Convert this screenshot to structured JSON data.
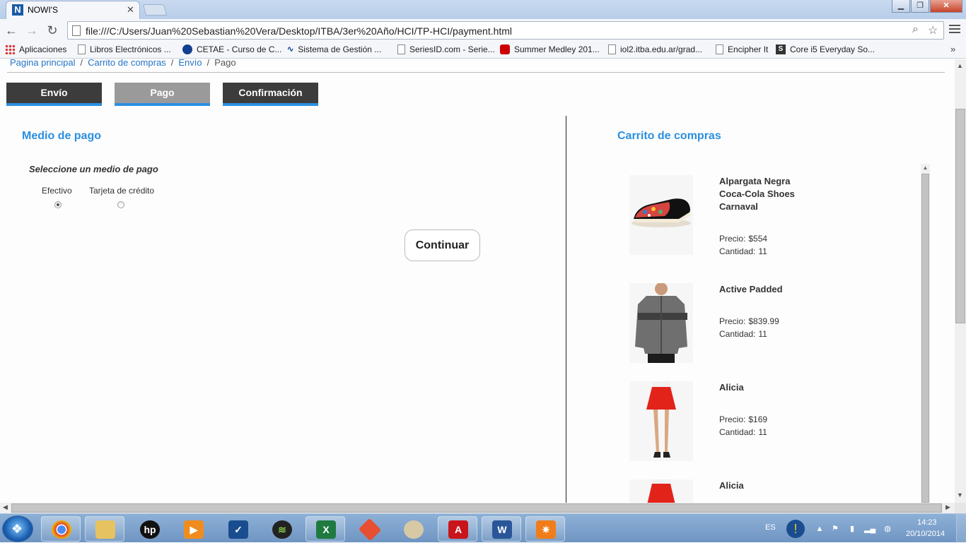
{
  "browser": {
    "tab_title": "NOWI'S",
    "tab_favicon": "N",
    "url": "file:///C:/Users/Juan%20Sebastian%20Vera/Desktop/ITBA/3er%20Año/HCI/TP-HCI/payment.html",
    "bookmarks": [
      {
        "label": "Aplicaciones",
        "icon": "apps-grid-icon"
      },
      {
        "label": "Libros Electrónicos ...",
        "icon": "page-icon"
      },
      {
        "label": "CETAE - Curso de C...",
        "icon": "cetae-icon"
      },
      {
        "label": "Sistema de Gestión ...",
        "icon": "wave-icon"
      },
      {
        "label": "SeriesID.com - Serie...",
        "icon": "page-icon"
      },
      {
        "label": "Summer Medley 201...",
        "icon": "youtube-icon"
      },
      {
        "label": "iol2.itba.edu.ar/grad...",
        "icon": "page-icon"
      },
      {
        "label": "Encipher It",
        "icon": "page-icon"
      },
      {
        "label": "Core i5 Everyday So...",
        "icon": "s-icon"
      }
    ]
  },
  "page": {
    "breadcrumb": {
      "home": "Pagina principal",
      "cart": "Carrito de compras",
      "shipping": "Envío",
      "current": "Pago"
    },
    "steps": [
      {
        "label": "Envío",
        "state": "done"
      },
      {
        "label": "Pago",
        "state": "current"
      },
      {
        "label": "Confirmación",
        "state": "pending"
      }
    ],
    "payment": {
      "title": "Medio de pago",
      "prompt": "Seleccione un medio de pago",
      "options": [
        {
          "label": "Efectivo",
          "checked": true
        },
        {
          "label": "Tarjeta de crédito",
          "checked": false
        }
      ],
      "continue_label": "Continuar"
    },
    "cart": {
      "title": "Carrito de compras",
      "price_label": "Precio:",
      "qty_label": "Cantidad:",
      "items": [
        {
          "name": "Alpargata Negra Coca-Cola Shoes Carnaval",
          "price": "$554",
          "qty": "11"
        },
        {
          "name": "Active Padded",
          "price": "$839.99",
          "qty": "11"
        },
        {
          "name": "Alicia",
          "price": "$169",
          "qty": "11"
        },
        {
          "name": "Alicia",
          "price": "",
          "qty": ""
        }
      ]
    }
  },
  "taskbar": {
    "apps": [
      "chrome-icon",
      "explorer-icon",
      "hp-icon",
      "media-player-icon",
      "tick-app-icon",
      "spotify-icon",
      "excel-icon",
      "git-icon",
      "paint-icon",
      "acrobat-icon",
      "word-icon",
      "settings-icon"
    ],
    "lang": "ES",
    "time": "14:23",
    "date": "20/10/2014"
  },
  "colors": {
    "accent": "#2b8fe0",
    "step_dark": "#3c3c3c",
    "step_current": "#9a9a9a"
  }
}
